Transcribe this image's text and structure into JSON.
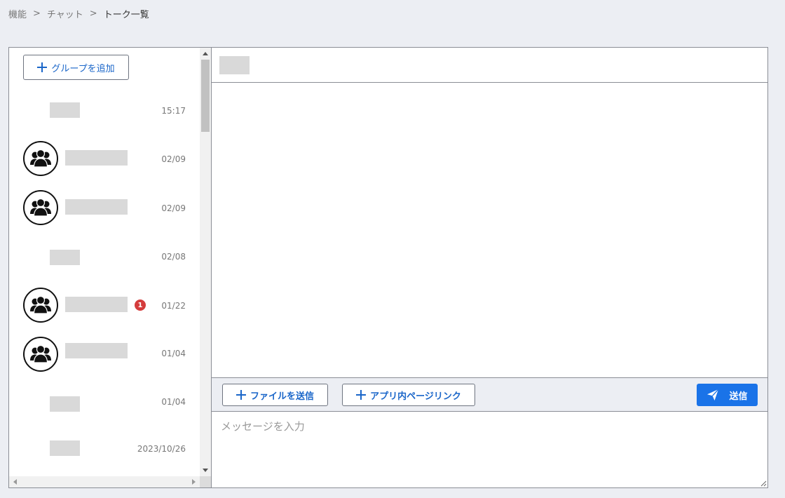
{
  "breadcrumb": {
    "items": [
      "機能",
      "チャット",
      "トーク一覧"
    ],
    "separator": ">"
  },
  "left": {
    "add_group_label": "グループを追加",
    "talks": [
      {
        "type": "direct",
        "time": "15:17",
        "unread": null
      },
      {
        "type": "group",
        "time": "02/09",
        "unread": null
      },
      {
        "type": "group",
        "time": "02/09",
        "unread": null
      },
      {
        "type": "direct",
        "time": "02/08",
        "unread": null
      },
      {
        "type": "group",
        "time": "01/22",
        "unread": "1"
      },
      {
        "type": "group",
        "time": "01/04",
        "unread": null
      },
      {
        "type": "direct",
        "time": "01/04",
        "unread": null
      },
      {
        "type": "direct",
        "time": "2023/10/26",
        "unread": null
      }
    ]
  },
  "toolbar": {
    "file_send_label": "ファイルを送信",
    "app_link_label": "アプリ内ページリンク",
    "send_label": "送信"
  },
  "input": {
    "placeholder": "メッセージを入力"
  },
  "colors": {
    "accent": "#1a73e8",
    "badge": "#d43c3c",
    "placeholder_block": "#d9d9d9"
  }
}
